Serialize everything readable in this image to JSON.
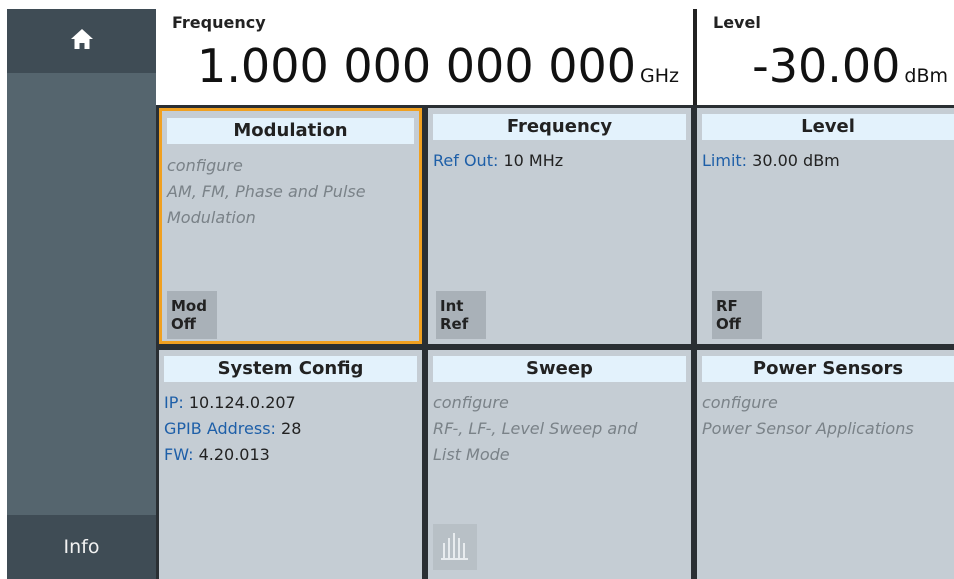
{
  "sidebar": {
    "info_label": "Info"
  },
  "topbar": {
    "frequency": {
      "label": "Frequency",
      "value": "1.000 000 000 000",
      "unit": "GHz"
    },
    "level": {
      "label": "Level",
      "value": "-30.00",
      "unit": "dBm"
    }
  },
  "tiles": {
    "modulation": {
      "title": "Modulation",
      "desc1": "configure",
      "desc2": "AM, FM, Phase and Pulse",
      "desc3": "Modulation",
      "button": [
        "Mod",
        "Off"
      ]
    },
    "frequency": {
      "title": "Frequency",
      "key": "Ref Out",
      "value": "10 MHz",
      "button": [
        "Int",
        "Ref"
      ]
    },
    "level": {
      "title": "Level",
      "key": "Limit",
      "value": "30.00 dBm",
      "button": [
        "RF",
        "Off"
      ]
    },
    "system_config": {
      "title": "System Config",
      "ip_key": "IP",
      "ip_value": "10.124.0.207",
      "gpib_key": "GPIB Address",
      "gpib_value": "28",
      "fw_key": "FW",
      "fw_value": "4.20.013"
    },
    "sweep": {
      "title": "Sweep",
      "desc1": "configure",
      "desc2": "RF-, LF-, Level Sweep and",
      "desc3": "List Mode"
    },
    "power_sensors": {
      "title": "Power Sensors",
      "desc1": "configure",
      "desc2": "Power Sensor Applications"
    }
  },
  "colors": {
    "accent_selected": "#f0a020",
    "tile_bg": "#c5cdd4",
    "header_bg": "#e3f2fc",
    "key_blue": "#1e5fa8"
  }
}
